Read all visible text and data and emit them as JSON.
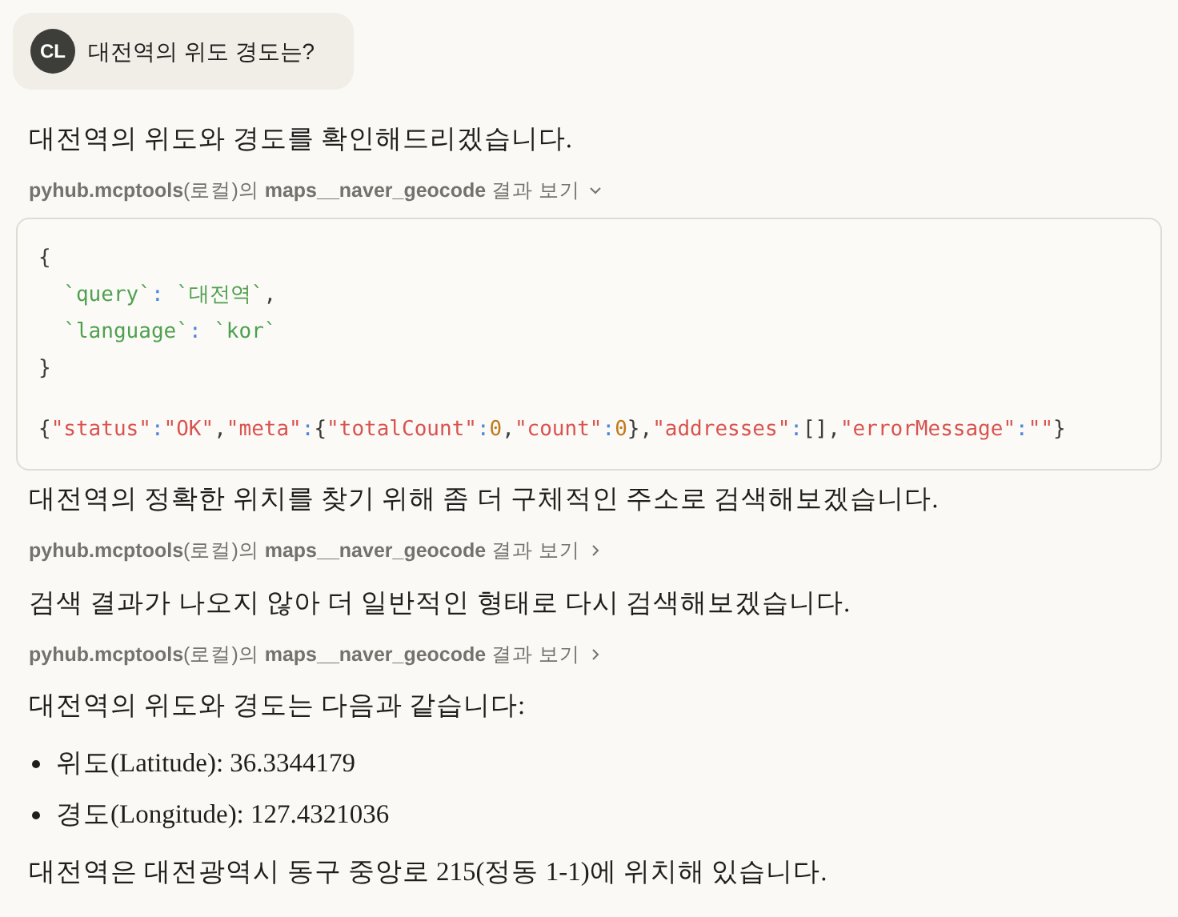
{
  "user_message": {
    "avatar": "CL",
    "text": "대전역의 위도 경도는?"
  },
  "blocks": [
    {
      "kind": "text",
      "text": "대전역의 위도와 경도를 확인해드리겠습니다."
    },
    {
      "kind": "tool",
      "label": "**pyhub.mcptools**(로컬)의 **maps__naver_geocode** 결과 보기",
      "expanded": true,
      "input_lines": [
        "{",
        "  `query`: `대전역`,",
        "  `language`: `kor`",
        "}"
      ],
      "output": "{\"status\":\"OK\",\"meta\":{\"totalCount\":0,\"count\":0},\"addresses\":[],\"errorMessage\":\"\"}"
    },
    {
      "kind": "text",
      "text": "대전역의 정확한 위치를 찾기 위해 좀 더 구체적인 주소로 검색해보겠습니다."
    },
    {
      "kind": "tool",
      "label": "**pyhub.mcptools**(로컬)의 **maps__naver_geocode** 결과 보기",
      "expanded": false
    },
    {
      "kind": "text",
      "text": "검색 결과가 나오지 않아 더 일반적인 형태로 다시 검색해보겠습니다."
    },
    {
      "kind": "tool",
      "label": "**pyhub.mcptools**(로컬)의 **maps__naver_geocode** 결과 보기",
      "expanded": false
    },
    {
      "kind": "text",
      "text": "대전역의 위도와 경도는 다음과 같습니다:"
    },
    {
      "kind": "list",
      "items": [
        "위도(Latitude): 36.3344179",
        "경도(Longitude): 127.4321036"
      ]
    },
    {
      "kind": "text",
      "text": "대전역은 대전광역시 동구 중앙로 215(정동 1-1)에 위치해 있습니다."
    }
  ]
}
